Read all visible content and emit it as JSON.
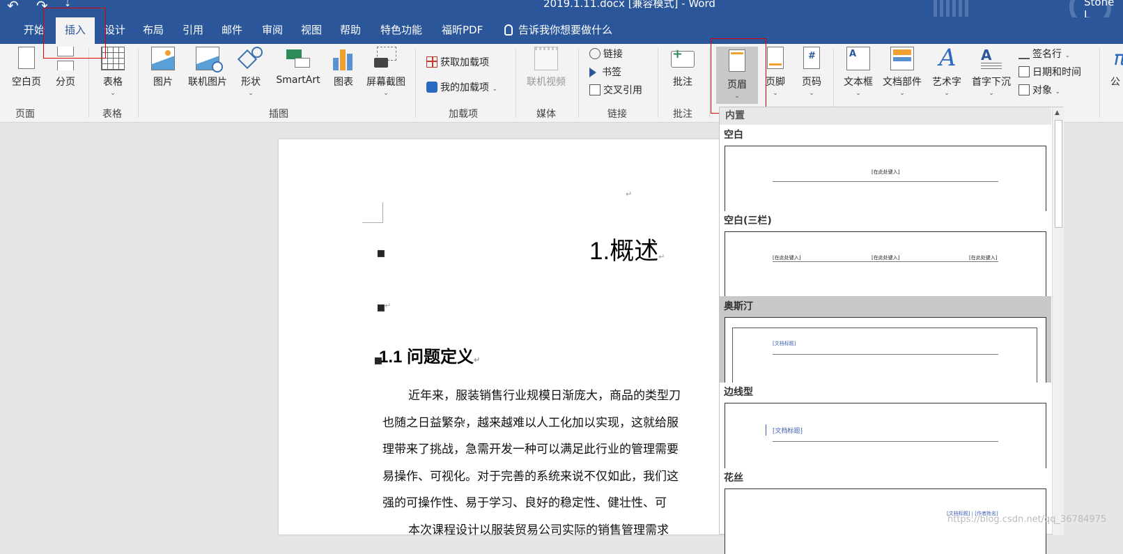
{
  "title_bar": {
    "document_title": "2019.1.11.docx [兼容模式] - Word",
    "user": "Stone L",
    "undo_glyph": "↶",
    "redo_glyph": "↷",
    "customize_glyph": "⇣"
  },
  "tabs": [
    {
      "label": "开始"
    },
    {
      "label": "插入",
      "active": true
    },
    {
      "label": "设计"
    },
    {
      "label": "布局"
    },
    {
      "label": "引用"
    },
    {
      "label": "邮件"
    },
    {
      "label": "审阅"
    },
    {
      "label": "视图"
    },
    {
      "label": "帮助"
    },
    {
      "label": "特色功能"
    },
    {
      "label": "福昕PDF"
    }
  ],
  "tell_me": {
    "text": "告诉我你想要做什么",
    "icon": "lightbulb-icon"
  },
  "ribbon": {
    "groups": {
      "pages": "页面",
      "tables": "表格",
      "illustrations": "插图",
      "addins": "加载项",
      "media": "媒体",
      "links": "链接",
      "comments": "批注"
    },
    "pages": {
      "cover": "空白页",
      "page_break": "分页"
    },
    "tables": {
      "table": "表格"
    },
    "illustrations": {
      "pictures": "图片",
      "online_pictures": "联机图片",
      "shapes": "形状",
      "smartart": "SmartArt",
      "chart": "图表",
      "screenshot": "屏幕截图"
    },
    "addins": {
      "get": "获取加载项",
      "my": "我的加载项"
    },
    "media": {
      "online_video": "联机视频"
    },
    "links": {
      "link": "链接",
      "bookmark": "书签",
      "cross_ref": "交叉引用"
    },
    "comments": {
      "comment": "批注"
    },
    "header_footer": {
      "header": "页眉",
      "footer": "页脚",
      "page_number": "页码"
    },
    "text": {
      "textbox": "文本框",
      "quick_parts": "文档部件",
      "wordart": "艺术字",
      "dropcap": "首字下沉",
      "signature": "签名行",
      "datetime": "日期和时间",
      "object": "对象",
      "equation": "公"
    },
    "dropdown_glyph": "⌄"
  },
  "document": {
    "return_mark": "↵",
    "heading1": "1.概述",
    "heading2": "1.1 问题定义",
    "paragraph_lines": [
      "近年来，服装销售行业规模日渐庞大，商品的类型刀",
      "也随之日益繁杂，越来越难以人工化加以实现，这就给服",
      "理带来了挑战，急需开发一种可以满足此行业的管理需要",
      "易操作、可视化。对于完善的系统来说不仅如此，我们这",
      "强的可操作性、易于学习、良好的稳定性、健壮性、可"
    ],
    "last_line_partial": "本次课程设计以服装贸易公司实际的销售管理需求"
  },
  "header_gallery": {
    "section_label": "内置",
    "items": [
      {
        "name": "空白",
        "texts": [
          "[在此处键入]"
        ]
      },
      {
        "name": "空白(三栏)",
        "texts": [
          "[在此处键入]",
          "[在此处键入]",
          "[在此处键入]"
        ]
      },
      {
        "name": "奥斯汀",
        "texts": [
          "[文档标题]"
        ],
        "selected": true
      },
      {
        "name": "边线型",
        "texts": [
          "[文档标题]"
        ]
      },
      {
        "name": "花丝",
        "texts": [
          "[文档标题] | [作者姓名]"
        ]
      }
    ],
    "scroll_up_glyph": "▲"
  },
  "watermark": "https://blog.csdn.net/qq_36784975",
  "colors": {
    "accent": "#2b579a",
    "ribbon_bg": "#f3f3f3",
    "highlight_box": "#e00000"
  }
}
